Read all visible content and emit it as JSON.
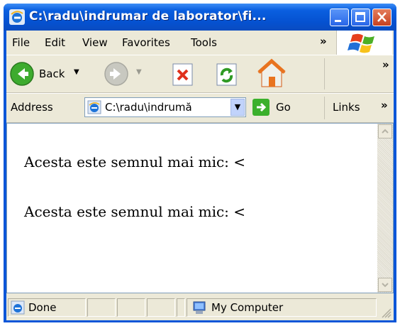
{
  "window": {
    "title": "C:\\radu\\indrumar de laborator\\fi..."
  },
  "menu": {
    "items": [
      "File",
      "Edit",
      "View",
      "Favorites",
      "Tools"
    ],
    "more": "»"
  },
  "toolbar": {
    "back_label": "Back",
    "more": "»"
  },
  "address": {
    "label": "Address",
    "value": "C:\\radu\\indrumă",
    "go_label": "Go",
    "links_label": "Links",
    "links_more": "»"
  },
  "content": {
    "lines": [
      "Acesta este semnul mai mic: <",
      "Acesta este semnul mai mic: <"
    ]
  },
  "status": {
    "text": "Done",
    "zone": "My Computer"
  }
}
